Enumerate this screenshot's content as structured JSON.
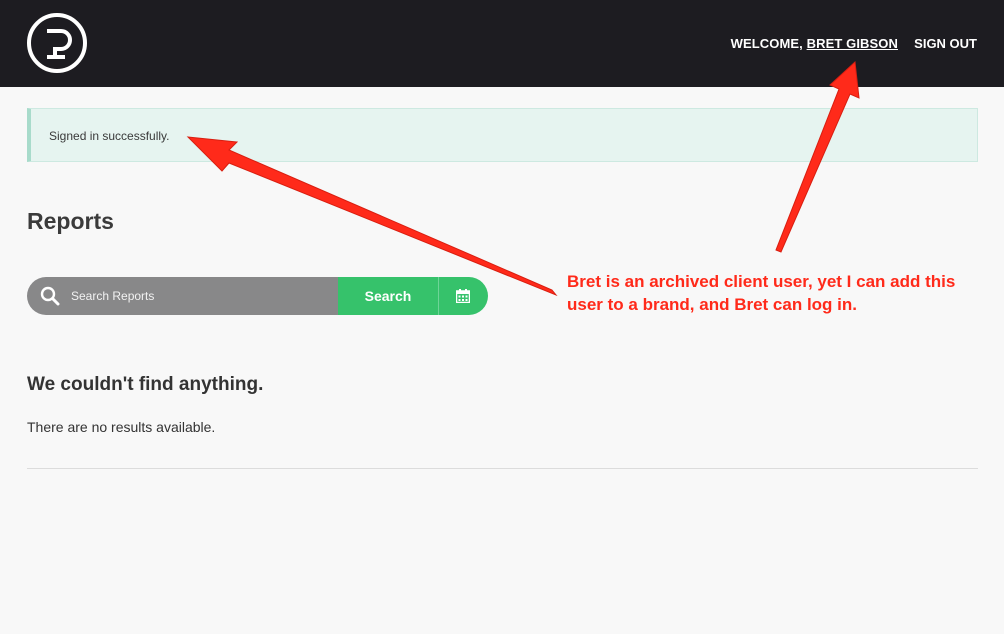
{
  "header": {
    "welcome_prefix": "WELCOME,",
    "user_name": "BRET GIBSON",
    "sign_out": "SIGN OUT"
  },
  "flash": {
    "message": "Signed in successfully."
  },
  "page": {
    "title": "Reports"
  },
  "search": {
    "placeholder": "Search Reports",
    "button_label": "Search",
    "icon": "search-icon",
    "calendar_icon": "calendar-icon"
  },
  "empty_state": {
    "title": "We couldn't find anything.",
    "message": "There are no results available."
  },
  "annotation": {
    "text": "Bret is an archived client user, yet I can add this user to a brand, and Bret can log in.",
    "color": "#ff2a1a"
  },
  "colors": {
    "header_bg": "#1d1c21",
    "accent_green": "#36c26b",
    "flash_bg": "#e6f4f0"
  }
}
